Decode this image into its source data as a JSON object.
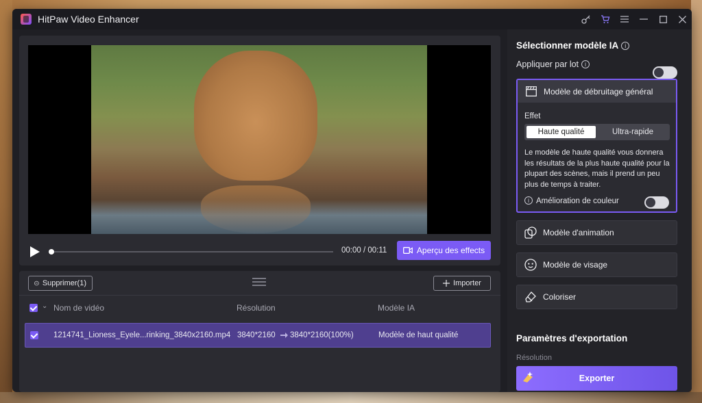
{
  "app": {
    "title": "HitPaw Video Enhancer"
  },
  "player": {
    "time": "00:00 / 00:11",
    "progress_fraction": 0.0,
    "preview_label": "Aperçu des effects"
  },
  "list": {
    "delete_label": "Supprimer(1)",
    "import_label": "Importer",
    "headers": {
      "name": "Nom de vidéo",
      "resolution": "Résolution",
      "model": "Modèle IA"
    },
    "rows": [
      {
        "name": "1214741_Lioness_Eyele...rinking_3840x2160.mp4",
        "res_from": "3840*2160",
        "res_to": "3840*2160(100%)",
        "model": "Modèle de haut qualité",
        "checked": true
      }
    ]
  },
  "side": {
    "title": "Sélectionner modèle IA",
    "batch_label": "Appliquer par lot",
    "batch_on": false,
    "models": {
      "denoise": "Modèle de débruitage général",
      "animation": "Modèle d'animation",
      "face": "Modèle de visage",
      "colorize": "Coloriser"
    },
    "effect_label": "Effet",
    "effect_options": [
      "Haute qualité",
      "Ultra-rapide"
    ],
    "effect_selected": "Haute qualité",
    "description": "Le modèle de haute qualité vous donnera les résultats de la plus haute qualité pour la plupart des scènes, mais il prend un peu plus de temps à traiter.",
    "color_label": "Amélioration de couleur",
    "color_on": false,
    "export_title": "Paramètres d'exportation",
    "resolution_label": "Résolution",
    "export_label": "Exporter"
  },
  "colors": {
    "accent": "#7b5bf5",
    "row_selected": "#4f3f8f",
    "panel": "#2b2b31"
  }
}
